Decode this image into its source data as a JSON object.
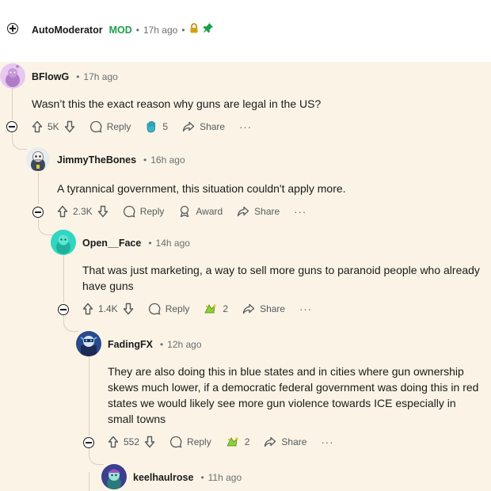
{
  "comments": [
    {
      "author": "AutoModerator",
      "mod_badge": "MOD",
      "time": "17h ago",
      "lock_icon": "lock-icon",
      "pin_icon": "pin-icon",
      "mod_color": "#1aa04a"
    },
    {
      "author": "BFlowG",
      "time": "17h ago",
      "text": "Wasn’t this the exact reason why guns are legal in the US?",
      "votes": "5K",
      "reply": "Reply",
      "award_count": "5",
      "share": "Share"
    },
    {
      "author": "JimmyTheBones",
      "time": "16h ago",
      "text": "A tyrannical government, this situation couldn't apply more.",
      "votes": "2.3K",
      "reply": "Reply",
      "award": "Award",
      "share": "Share"
    },
    {
      "author": "Open__Face",
      "time": "14h ago",
      "text": "That was just marketing, a way to sell more guns to paranoid people who already have guns",
      "votes": "1.4K",
      "reply": "Reply",
      "award_count": "2",
      "share": "Share"
    },
    {
      "author": "FadingFX",
      "time": "12h ago",
      "text": "They are also doing this in blue states and in cities where gun ownership skews much lower, if a democratic federal government was doing this in red states we would likely see more gun violence towards ICE especially in small towns",
      "votes": "552",
      "reply": "Reply",
      "award_count": "2",
      "share": "Share"
    },
    {
      "author": "keelhaulrose",
      "time": "11h ago"
    }
  ],
  "separator": "•",
  "more": "···",
  "colors": {
    "highlight": "#fbf4e6",
    "thread_line": "#d9cfbd",
    "mod_green": "#1aa04a"
  }
}
